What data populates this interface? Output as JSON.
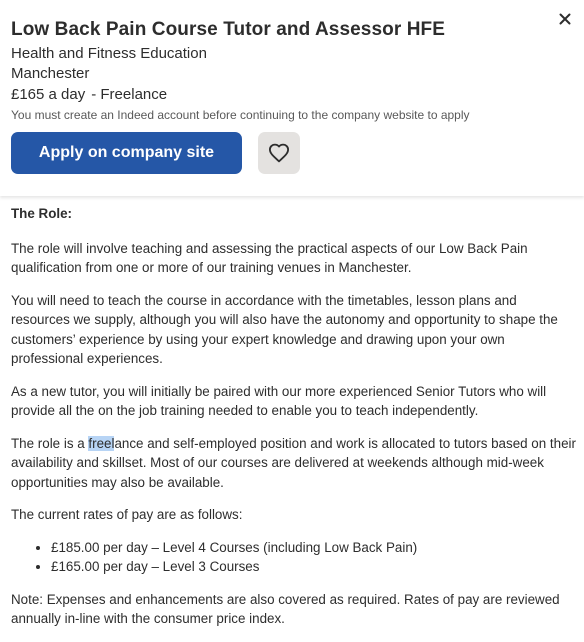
{
  "header": {
    "title": "Low Back Pain Course Tutor and Assessor HFE",
    "company": "Health and Fitness Education",
    "location": "Manchester",
    "salary": "£165 a day",
    "job_type": "- Freelance",
    "notice": "You must create an Indeed account before continuing to the company website to apply",
    "apply_label": "Apply on company site",
    "close_icon": "close-icon",
    "save_icon": "heart-icon",
    "accent_color": "#2557a7"
  },
  "description": {
    "heading": "The Role:",
    "para1": "The role will involve teaching and assessing the practical aspects of our Low Back Pain qualification from one or more of our training venues in Manchester.",
    "para2": "You will need to teach the course in accordance with the timetables, lesson plans and resources we supply, although you will also have the autonomy and opportunity to shape the customers’ experience by using your expert knowledge and drawing upon your own professional experiences.",
    "para3": "As a new tutor, you will initially be paired with our more experienced Senior Tutors who will provide all the on the job training needed to enable you to teach independently.",
    "para4_before": "The role is a ",
    "para4_highlight": "freel",
    "para4_after": "ance and self-employed position and work is allocated to tutors based on their availability and skillset. Most of our courses are delivered at weekends although mid-week opportunities may also be available.",
    "para5": "The current rates of pay are as follows:",
    "rates": [
      "£185.00 per day – Level 4 Courses (including Low Back Pain)",
      "£165.00 per day – Level 3 Courses"
    ],
    "para6": "Note: Expenses and enhancements are also covered as required. Rates of pay are reviewed annually in-line with the consumer price index."
  }
}
